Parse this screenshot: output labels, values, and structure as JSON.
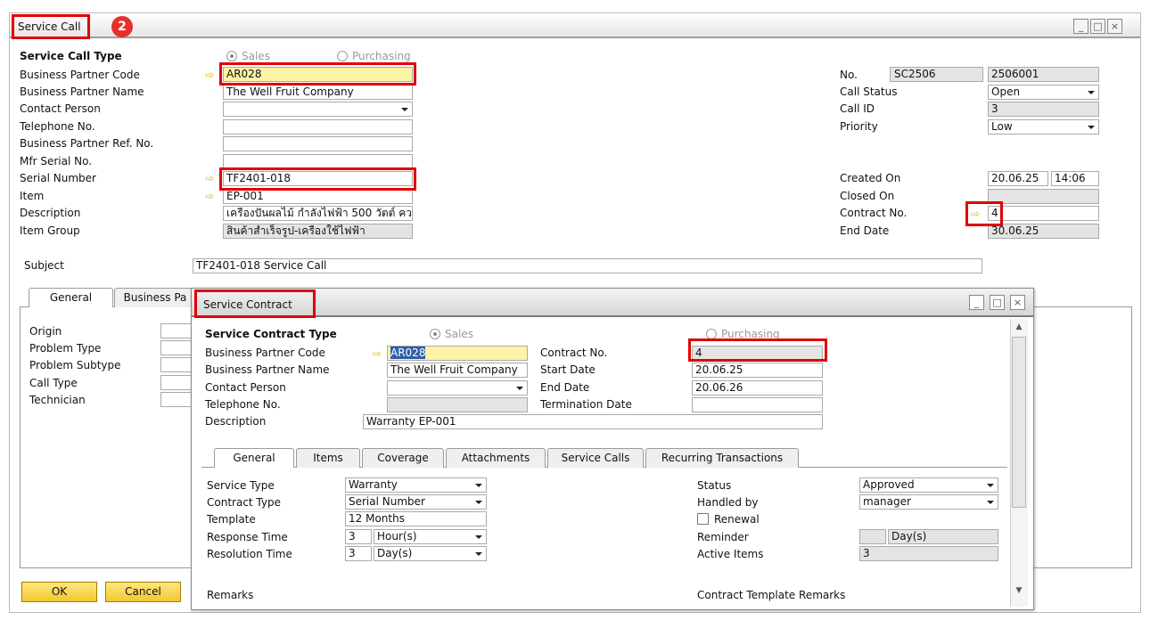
{
  "main": {
    "title": "Service Call",
    "step_badge": "2",
    "type_header": "Service Call Type",
    "radio_sales": "Sales",
    "radio_purchasing": "Purchasing",
    "left_labels": [
      "Business Partner Code",
      "Business Partner Name",
      "Contact Person",
      "Telephone No.",
      "Business Partner Ref. No.",
      "Mfr Serial No.",
      "Serial Number",
      "Item",
      "Description",
      "Item Group"
    ],
    "bp_code": "AR028",
    "bp_name": "The Well Fruit Company",
    "serial_number": "TF2401-018",
    "item": "EP-001",
    "description": "เครื่องปั่นผลไม้ กำลังไฟฟ้า 500 วัตต์ คว",
    "item_group": "สินค้าสำเร็จรูป-เครื่องใช้ไฟฟ้า",
    "right_labels": [
      "No.",
      "Call Status",
      "Call ID",
      "Priority",
      "Created On",
      "Closed On",
      "Contract No.",
      "End Date"
    ],
    "no_series": "SC2506",
    "no_value": "2506001",
    "call_status": "Open",
    "call_id": "3",
    "priority": "Low",
    "created_date": "20.06.25",
    "created_time": "14:06",
    "contract_no": "4",
    "end_date": "30.06.25",
    "subject_label": "Subject",
    "subject": "TF2401-018 Service Call",
    "tabs": [
      "General",
      "Business Pa"
    ],
    "tab_labels": [
      "Origin",
      "Problem Type",
      "Problem Subtype",
      "Call Type",
      "Technician"
    ],
    "ok": "OK",
    "cancel": "Cancel"
  },
  "contract": {
    "title": "Service Contract",
    "type_header": "Service Contract Type",
    "radio_sales": "Sales",
    "radio_purchasing": "Purchasing",
    "labels": [
      "Business Partner Code",
      "Business Partner Name",
      "Contact Person",
      "Telephone No.",
      "Description"
    ],
    "bp_code": "AR028",
    "bp_name": "The Well Fruit Company",
    "description": "Warranty EP-001",
    "mid_labels": [
      "Contract No.",
      "Start Date",
      "End Date",
      "Termination Date"
    ],
    "contract_no": "4",
    "start_date": "20.06.25",
    "end_date": "20.06.26",
    "tabs": [
      "General",
      "Items",
      "Coverage",
      "Attachments",
      "Service Calls",
      "Recurring Transactions"
    ],
    "gen_labels": [
      "Service Type",
      "Contract Type",
      "Template",
      "Response Time",
      "Resolution Time"
    ],
    "service_type": "Warranty",
    "contract_type": "Serial Number",
    "template": "12 Months",
    "response_num": "3",
    "response_unit": "Hour(s)",
    "resolution_num": "3",
    "resolution_unit": "Day(s)",
    "status_label": "Status",
    "status": "Approved",
    "handled_label": "Handled by",
    "handled": "manager",
    "renewal": "Renewal",
    "reminder_label": "Reminder",
    "reminder_unit": "Day(s)",
    "active_items_label": "Active Items",
    "active_items": "3",
    "remarks": "Remarks",
    "template_remarks": "Contract Template Remarks"
  },
  "colors": {
    "highlight": "#e00000",
    "field_yellow": "#fff3a6",
    "title_bar": "#dcdcdc"
  }
}
